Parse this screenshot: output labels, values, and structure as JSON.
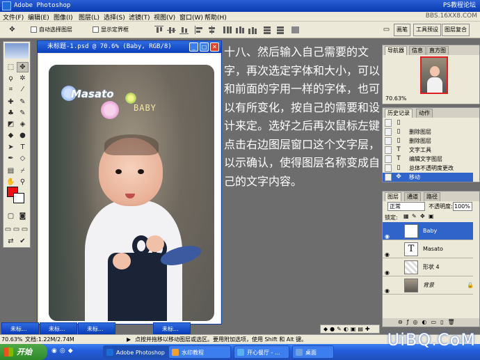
{
  "app": {
    "title": "Adobe Photoshop",
    "watermark": "PS教程论坛",
    "watermark2": "BBS.16XX8.COM"
  },
  "menu": [
    "文件(F)",
    "编辑(E)",
    "图像(I)",
    "图层(L)",
    "选择(S)",
    "滤镜(T)",
    "视图(V)",
    "窗口(W)",
    "帮助(H)"
  ],
  "options": {
    "auto_select": "自动选择图层",
    "show_bounds": "显示定界框"
  },
  "wells": [
    "画笔",
    "工具预设",
    "图层复合"
  ],
  "document": {
    "title": "未标题-1.psd @ 70.6% (Baby, RGB/8)",
    "photo_text": {
      "masato": "Masato",
      "baby": "BABY"
    }
  },
  "article": "十八、然后输入自己需要的文字，再次选定字体和大小，可以和前面的字用一样的字体，也可以有所变化，按自己的需要和设计来定。选好之后再次鼠标左键点击右边图层窗口这个文字层，以示确认，使得图层名称变成自己的文字内容。",
  "navigator": {
    "tabs": [
      "导航器",
      "信息",
      "直方图"
    ],
    "zoom": "70.63%"
  },
  "history": {
    "tabs": [
      "历史记录",
      "动作"
    ],
    "items": [
      {
        "icon": "tool",
        "label": ""
      },
      {
        "icon": "tool",
        "label": "删除图层"
      },
      {
        "icon": "tool",
        "label": "删除图层"
      },
      {
        "icon": "type",
        "label": "文字工具"
      },
      {
        "icon": "type",
        "label": "编辑文字图层"
      },
      {
        "icon": "tool",
        "label": "总体不透明度更改"
      },
      {
        "icon": "move",
        "label": "移动"
      }
    ]
  },
  "layers": {
    "tabs": [
      "图层",
      "通道",
      "路径"
    ],
    "blend_mode": "正常",
    "opacity_label": "不透明度:",
    "opacity": "100%",
    "lock_label": "锁定:",
    "items": [
      {
        "name": "Baby",
        "thumb": "T",
        "selected": true
      },
      {
        "name": "Masato",
        "thumb": "T",
        "selected": false
      },
      {
        "name": "形状 4",
        "thumb": "",
        "selected": false
      },
      {
        "name": "背景",
        "thumb": "",
        "selected": false
      }
    ]
  },
  "minimized_docs": [
    "未标...",
    "未标...",
    "未标...",
    "未标..."
  ],
  "status": {
    "zoom": "70.63%",
    "doc": "文档:1.22M/2.74M",
    "hint": "点按并拖移以移动图层或选区。要用附加选项，使用 Shift 和 Alt 键。"
  },
  "taskbar": {
    "start": "开始",
    "buttons": [
      "Adobe Photoshop",
      "水印教程",
      "开心餐厅 - ...",
      "桌面"
    ]
  },
  "footer_logo": "UiBQ.CoM"
}
